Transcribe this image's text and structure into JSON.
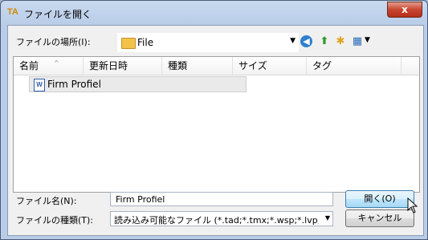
{
  "window": {
    "title": "ファイルを開く",
    "app_icon_text": "TA",
    "close_symbol": "x"
  },
  "location": {
    "label": "ファイルの場所(I):",
    "value": "File"
  },
  "toolbar": {
    "icons": [
      "back-icon",
      "up-folder-icon",
      "new-folder-icon",
      "views-icon"
    ]
  },
  "list": {
    "columns": [
      "名前",
      "更新日時",
      "種類",
      "サイズ",
      "タグ"
    ],
    "items": [
      {
        "name": "Firm Profiel",
        "icon": "word-document-icon"
      }
    ]
  },
  "filename": {
    "label": "ファイル名(N):",
    "value": "Firm Profiel"
  },
  "filetype": {
    "label": "ファイルの種類(T):",
    "value": "読み込み可能なファイル (*.tad;*.tmx;*.wsp;*.lvp;*.h"
  },
  "buttons": {
    "open": "開く(O)",
    "cancel": "キャンセル"
  }
}
